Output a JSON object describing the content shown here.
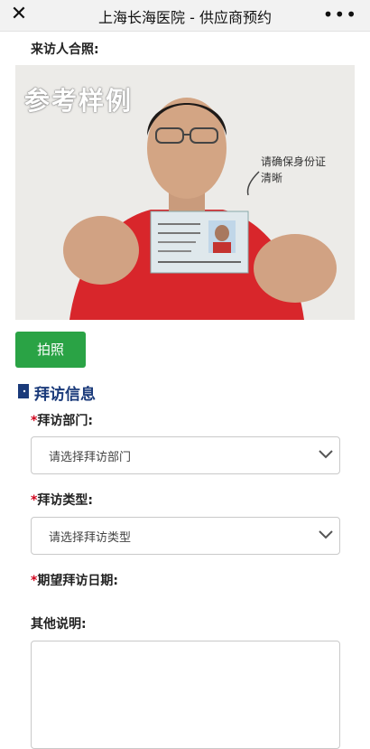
{
  "header": {
    "title": "上海长海医院 - 供应商预约",
    "close_icon": "close-icon",
    "more_icon": "more-icon",
    "more_glyph": "•••"
  },
  "photo_section": {
    "label": "来访人合照:",
    "sample_text": "参考样例",
    "note": "请确保身份证清晰",
    "button_label": "拍照"
  },
  "visit_info": {
    "title": "拜访信息",
    "icon": "door-icon",
    "department": {
      "label": "拜访部门:",
      "placeholder": "请选择拜访部门"
    },
    "type": {
      "label": "拜访类型:",
      "placeholder": "请选择拜访类型"
    },
    "date": {
      "label": "期望拜访日期:"
    },
    "notes": {
      "label": "其他说明:"
    },
    "required_mark": "*"
  },
  "colors": {
    "primary_button": "#2aa345",
    "section_title": "#1a3a7a",
    "required": "#d0021b"
  }
}
